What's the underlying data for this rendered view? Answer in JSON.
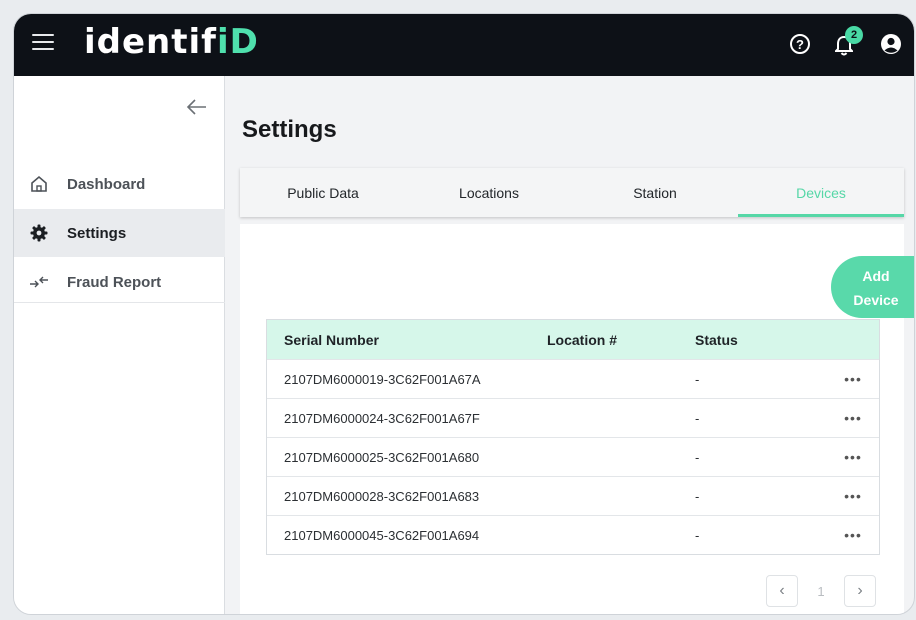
{
  "app": {
    "logo_text": "identif",
    "logo_accent": "iD"
  },
  "topbar": {
    "notification_count": "2",
    "help_glyph": "?"
  },
  "sidebar": {
    "collapse_glyph": "←",
    "items": [
      {
        "label": "Dashboard",
        "icon": "home-icon",
        "active": false
      },
      {
        "label": "Settings",
        "icon": "gear-icon",
        "active": true
      },
      {
        "label": "Fraud Report",
        "icon": "transfer-arrows-icon",
        "active": false
      }
    ]
  },
  "main": {
    "page_title": "Settings",
    "tabs": [
      {
        "label": "Public Data"
      },
      {
        "label": "Locations"
      },
      {
        "label": "Station"
      },
      {
        "label": "Devices",
        "active": true
      }
    ],
    "add_button": {
      "line1": "Add",
      "line2": "Device"
    },
    "table": {
      "headers": [
        "Serial Number",
        "Location #",
        "Status",
        ""
      ],
      "rows": [
        {
          "serial": "2107DM6000019-3C62F001A67A",
          "location": "",
          "status": "-",
          "actions": "•••"
        },
        {
          "serial": "2107DM6000024-3C62F001A67F",
          "location": "",
          "status": "-",
          "actions": "•••"
        },
        {
          "serial": "2107DM6000025-3C62F001A680",
          "location": "",
          "status": "-",
          "actions": "•••"
        },
        {
          "serial": "2107DM6000028-3C62F001A683",
          "location": "",
          "status": "-",
          "actions": "•••"
        },
        {
          "serial": "2107DM6000045-3C62F001A694",
          "location": "",
          "status": "-",
          "actions": "•••"
        }
      ]
    },
    "pagination": {
      "prev": "‹",
      "page": "1",
      "next": "›"
    }
  },
  "colors": {
    "accent": "#56d7a7",
    "topbar": "#0d1117",
    "header_row": "#d6f7ea"
  }
}
